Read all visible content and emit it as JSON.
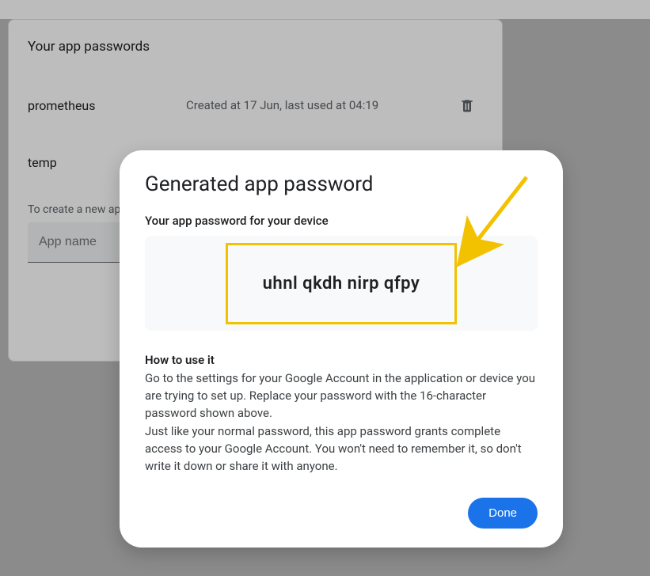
{
  "page": {
    "title": "Your app passwords",
    "items": [
      {
        "name": "prometheus",
        "meta": "Created at 17 Jun, last used at 04:19"
      },
      {
        "name": "temp",
        "meta": ""
      }
    ],
    "create_label": "To create a new app specific password...",
    "input_placeholder": "App name"
  },
  "modal": {
    "title": "Generated app password",
    "subtitle": "Your app password for your device",
    "password": "uhnl qkdh nirp qfpy",
    "howto_title": "How to use it",
    "howto_p1": "Go to the settings for your Google Account in the application or device you are trying to set up. Replace your password with the 16-character password shown above.",
    "howto_p2": "Just like your normal password, this app password grants complete access to your Google Account. You won't need to remember it, so don't write it down or share it with anyone.",
    "done_label": "Done"
  },
  "colors": {
    "highlight": "#f2c200",
    "primary": "#1a73e8"
  }
}
